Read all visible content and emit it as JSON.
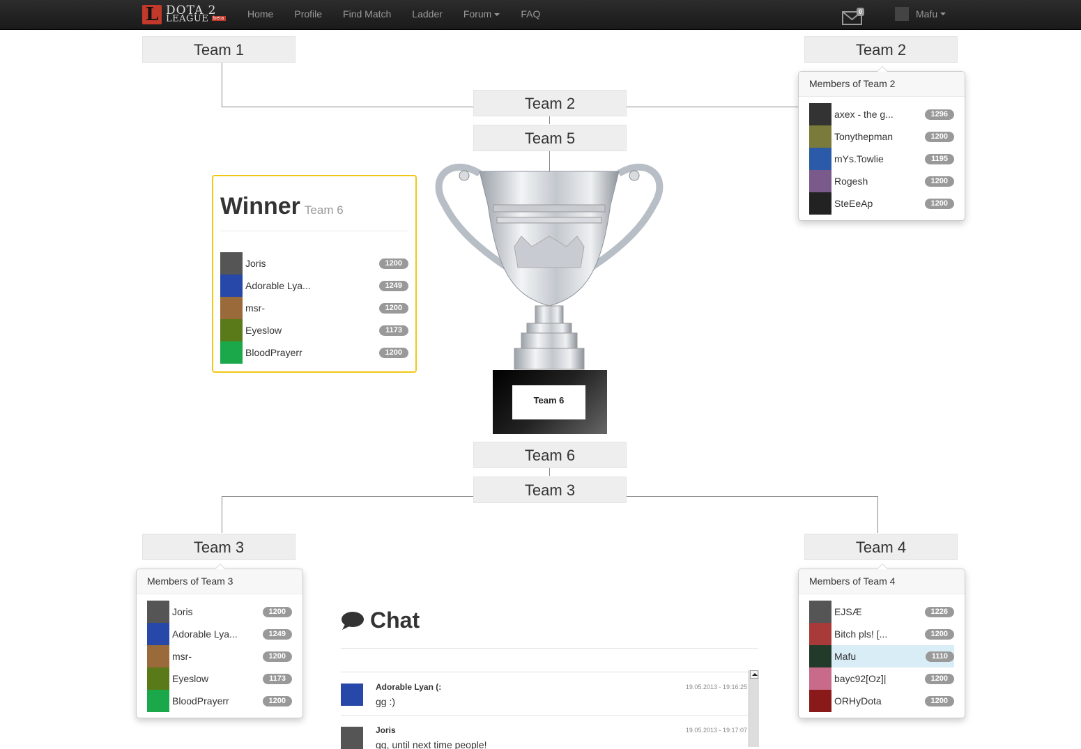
{
  "nav": {
    "logo_letter": "L",
    "logo_line1": "DOTA 2",
    "logo_line2": "LEAGUE",
    "logo_beta": "beta",
    "items": [
      "Home",
      "Profile",
      "Find Match",
      "Ladder",
      "Forum",
      "FAQ"
    ],
    "mail_count": "0",
    "username": "Mafu"
  },
  "bracket": {
    "top_left": "Team 1",
    "top_right": "Team 2",
    "semi_top_a": "Team 2",
    "semi_top_b": "Team 5",
    "semi_bot_a": "Team 6",
    "semi_bot_b": "Team 3",
    "bot_left": "Team 3",
    "bot_right": "Team 4",
    "champion_plate": "Team 6"
  },
  "winner": {
    "label": "Winner",
    "team": "Team 6",
    "members": [
      {
        "name": "Joris",
        "rating": "1200",
        "avatar": "#555"
      },
      {
        "name": "Adorable Lya...",
        "rating": "1249",
        "avatar": "#2748a8"
      },
      {
        "name": "msr-",
        "rating": "1200",
        "avatar": "#9a6a3a"
      },
      {
        "name": "Eyeslow",
        "rating": "1173",
        "avatar": "#5a7a1a"
      },
      {
        "name": "BloodPrayerr",
        "rating": "1200",
        "avatar": "#1aa84a"
      }
    ]
  },
  "popovers": {
    "team2": {
      "title": "Members of Team 2",
      "members": [
        {
          "name": "axex - the g...",
          "rating": "1296",
          "avatar": "#333"
        },
        {
          "name": "Tonythepman",
          "rating": "1200",
          "avatar": "#7a7a3a"
        },
        {
          "name": "mYs.Towlie",
          "rating": "1195",
          "avatar": "#2a5aa8"
        },
        {
          "name": "Rogesh",
          "rating": "1200",
          "avatar": "#7a5a8a"
        },
        {
          "name": "SteEeAp",
          "rating": "1200",
          "avatar": "#222"
        }
      ]
    },
    "team3": {
      "title": "Members of Team 3",
      "members": [
        {
          "name": "Joris",
          "rating": "1200",
          "avatar": "#555"
        },
        {
          "name": "Adorable Lya...",
          "rating": "1249",
          "avatar": "#2748a8"
        },
        {
          "name": "msr-",
          "rating": "1200",
          "avatar": "#9a6a3a"
        },
        {
          "name": "Eyeslow",
          "rating": "1173",
          "avatar": "#5a7a1a"
        },
        {
          "name": "BloodPrayerr",
          "rating": "1200",
          "avatar": "#1aa84a"
        }
      ]
    },
    "team4": {
      "title": "Members of Team 4",
      "members": [
        {
          "name": "EJSÆ",
          "rating": "1226",
          "avatar": "#555"
        },
        {
          "name": "Bitch pls! [...",
          "rating": "1200",
          "avatar": "#a83a3a"
        },
        {
          "name": "Mafu",
          "rating": "1110",
          "avatar": "#223a2a"
        },
        {
          "name": "bayc92[Oz]|",
          "rating": "1200",
          "avatar": "#c86a8a"
        },
        {
          "name": "ORHyDota",
          "rating": "1200",
          "avatar": "#8a1a1a"
        }
      ],
      "highlight_name": "Mafu"
    }
  },
  "chat": {
    "title": "Chat",
    "messages": [
      {
        "user": "Adorable Lyan (:",
        "text": "gg :)",
        "time": "19.05.2013 - 19:16:25",
        "avatar": "#2748a8"
      },
      {
        "user": "Joris",
        "text": "gg, until next time people!",
        "time": "19.05.2013 - 19:17:07",
        "avatar": "#555"
      }
    ]
  }
}
